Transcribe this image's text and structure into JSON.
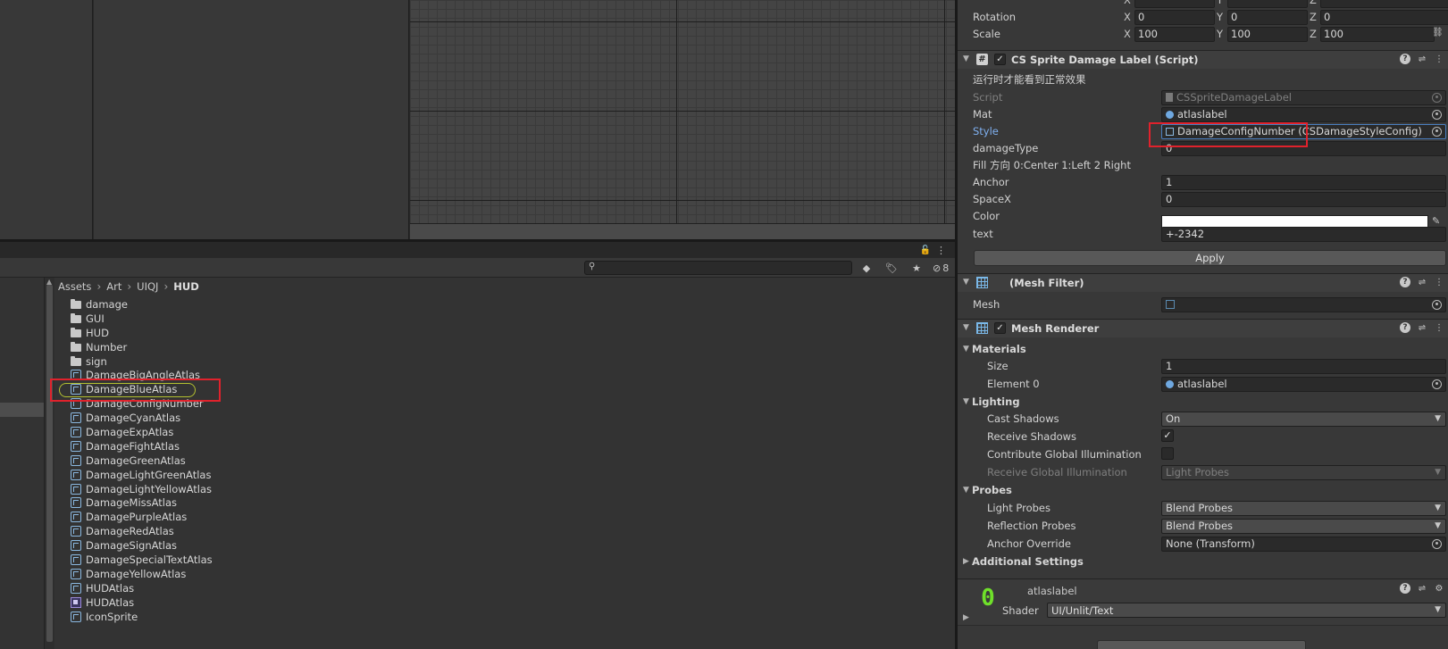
{
  "transform": {
    "rotation_label": "Rotation",
    "scale_label": "Scale",
    "axis_x": "X",
    "axis_y": "Y",
    "axis_z": "Z",
    "rotation": {
      "x": "0",
      "y": "0",
      "z": "0"
    },
    "scale": {
      "x": "100",
      "y": "100",
      "z": "100"
    }
  },
  "project": {
    "hidden_count": "8",
    "breadcrumb": [
      "Assets",
      "Art",
      "UIQJ",
      "HUD"
    ],
    "assets": [
      {
        "name": "damage",
        "type": "folder"
      },
      {
        "name": "GUI",
        "type": "folder"
      },
      {
        "name": "HUD",
        "type": "folder"
      },
      {
        "name": "Number",
        "type": "folder"
      },
      {
        "name": "sign",
        "type": "folder"
      },
      {
        "name": "DamageBigAngleAtlas",
        "type": "prefab"
      },
      {
        "name": "DamageBlueAtlas",
        "type": "prefab"
      },
      {
        "name": "DamageConfigNumber",
        "type": "prefab"
      },
      {
        "name": "DamageCyanAtlas",
        "type": "prefab"
      },
      {
        "name": "DamageExpAtlas",
        "type": "prefab"
      },
      {
        "name": "DamageFightAtlas",
        "type": "prefab"
      },
      {
        "name": "DamageGreenAtlas",
        "type": "prefab"
      },
      {
        "name": "DamageLightGreenAtlas",
        "type": "prefab"
      },
      {
        "name": "DamageLightYellowAtlas",
        "type": "prefab"
      },
      {
        "name": "DamageMissAtlas",
        "type": "prefab"
      },
      {
        "name": "DamagePurpleAtlas",
        "type": "prefab"
      },
      {
        "name": "DamageRedAtlas",
        "type": "prefab"
      },
      {
        "name": "DamageSignAtlas",
        "type": "prefab"
      },
      {
        "name": "DamageSpecialTextAtlas",
        "type": "prefab"
      },
      {
        "name": "DamageYellowAtlas",
        "type": "prefab"
      },
      {
        "name": "HUDAtlas",
        "type": "prefab"
      },
      {
        "name": "HUDAtlas",
        "type": "sprite"
      },
      {
        "name": "IconSprite",
        "type": "prefab"
      }
    ]
  },
  "damage_label": {
    "title": "CS Sprite Damage Label (Script)",
    "note": "运行时才能看到正常效果",
    "script_label": "Script",
    "script_value": "CSSpriteDamageLabel",
    "mat_label": "Mat",
    "mat_value": "atlaslabel",
    "style_label": "Style",
    "style_value": "DamageConfigNumber (CSDamageStyleConfig)",
    "damage_type_label": "damageType",
    "damage_type_value": "0",
    "fill_note": "Fill 方向 0:Center 1:Left 2 Right",
    "anchor_label": "Anchor",
    "anchor_value": "1",
    "spacex_label": "SpaceX",
    "spacex_value": "0",
    "color_label": "Color",
    "color_value": "#ffffff",
    "text_label": "text",
    "text_value": "+-2342",
    "apply_label": "Apply"
  },
  "mesh_filter": {
    "title": "(Mesh Filter)",
    "mesh_label": "Mesh",
    "mesh_value": ""
  },
  "mesh_renderer": {
    "title": "Mesh Renderer",
    "materials_label": "Materials",
    "size_label": "Size",
    "size_value": "1",
    "element0_label": "Element 0",
    "element0_value": "atlaslabel",
    "lighting_label": "Lighting",
    "cast_shadows_label": "Cast Shadows",
    "cast_shadows_value": "On",
    "receive_shadows_label": "Receive Shadows",
    "contribute_gi_label": "Contribute Global Illumination",
    "receive_gi_label": "Receive Global Illumination",
    "receive_gi_value": "Light Probes",
    "probes_label": "Probes",
    "light_probes_label": "Light Probes",
    "light_probes_value": "Blend Probes",
    "reflection_probes_label": "Reflection Probes",
    "reflection_probes_value": "Blend Probes",
    "anchor_override_label": "Anchor Override",
    "anchor_override_value": "None (Transform)",
    "additional_label": "Additional Settings"
  },
  "material": {
    "name": "atlaslabel",
    "shader_label": "Shader",
    "shader_value": "UI/Unlit/Text"
  }
}
